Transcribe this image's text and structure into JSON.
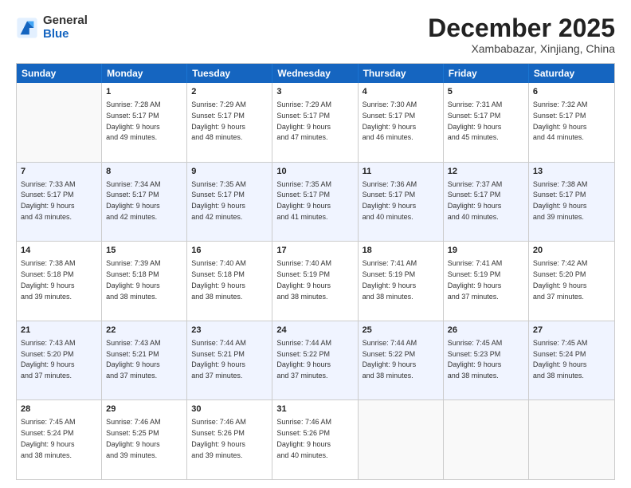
{
  "logo": {
    "general": "General",
    "blue": "Blue"
  },
  "header": {
    "month": "December 2025",
    "location": "Xambabazar, Xinjiang, China"
  },
  "days": [
    "Sunday",
    "Monday",
    "Tuesday",
    "Wednesday",
    "Thursday",
    "Friday",
    "Saturday"
  ],
  "weeks": [
    [
      {
        "empty": true
      },
      {
        "day": "1",
        "sunrise": "7:28 AM",
        "sunset": "5:17 PM",
        "daylight": "9 hours and 49 minutes."
      },
      {
        "day": "2",
        "sunrise": "7:29 AM",
        "sunset": "5:17 PM",
        "daylight": "9 hours and 48 minutes."
      },
      {
        "day": "3",
        "sunrise": "7:29 AM",
        "sunset": "5:17 PM",
        "daylight": "9 hours and 47 minutes."
      },
      {
        "day": "4",
        "sunrise": "7:30 AM",
        "sunset": "5:17 PM",
        "daylight": "9 hours and 46 minutes."
      },
      {
        "day": "5",
        "sunrise": "7:31 AM",
        "sunset": "5:17 PM",
        "daylight": "9 hours and 45 minutes."
      },
      {
        "day": "6",
        "sunrise": "7:32 AM",
        "sunset": "5:17 PM",
        "daylight": "9 hours and 44 minutes."
      }
    ],
    [
      {
        "day": "7",
        "sunrise": "7:33 AM",
        "sunset": "5:17 PM",
        "daylight": "9 hours and 43 minutes."
      },
      {
        "day": "8",
        "sunrise": "7:34 AM",
        "sunset": "5:17 PM",
        "daylight": "9 hours and 42 minutes."
      },
      {
        "day": "9",
        "sunrise": "7:35 AM",
        "sunset": "5:17 PM",
        "daylight": "9 hours and 42 minutes."
      },
      {
        "day": "10",
        "sunrise": "7:35 AM",
        "sunset": "5:17 PM",
        "daylight": "9 hours and 41 minutes."
      },
      {
        "day": "11",
        "sunrise": "7:36 AM",
        "sunset": "5:17 PM",
        "daylight": "9 hours and 40 minutes."
      },
      {
        "day": "12",
        "sunrise": "7:37 AM",
        "sunset": "5:17 PM",
        "daylight": "9 hours and 40 minutes."
      },
      {
        "day": "13",
        "sunrise": "7:38 AM",
        "sunset": "5:17 PM",
        "daylight": "9 hours and 39 minutes."
      }
    ],
    [
      {
        "day": "14",
        "sunrise": "7:38 AM",
        "sunset": "5:18 PM",
        "daylight": "9 hours and 39 minutes."
      },
      {
        "day": "15",
        "sunrise": "7:39 AM",
        "sunset": "5:18 PM",
        "daylight": "9 hours and 38 minutes."
      },
      {
        "day": "16",
        "sunrise": "7:40 AM",
        "sunset": "5:18 PM",
        "daylight": "9 hours and 38 minutes."
      },
      {
        "day": "17",
        "sunrise": "7:40 AM",
        "sunset": "5:19 PM",
        "daylight": "9 hours and 38 minutes."
      },
      {
        "day": "18",
        "sunrise": "7:41 AM",
        "sunset": "5:19 PM",
        "daylight": "9 hours and 38 minutes."
      },
      {
        "day": "19",
        "sunrise": "7:41 AM",
        "sunset": "5:19 PM",
        "daylight": "9 hours and 37 minutes."
      },
      {
        "day": "20",
        "sunrise": "7:42 AM",
        "sunset": "5:20 PM",
        "daylight": "9 hours and 37 minutes."
      }
    ],
    [
      {
        "day": "21",
        "sunrise": "7:43 AM",
        "sunset": "5:20 PM",
        "daylight": "9 hours and 37 minutes."
      },
      {
        "day": "22",
        "sunrise": "7:43 AM",
        "sunset": "5:21 PM",
        "daylight": "9 hours and 37 minutes."
      },
      {
        "day": "23",
        "sunrise": "7:44 AM",
        "sunset": "5:21 PM",
        "daylight": "9 hours and 37 minutes."
      },
      {
        "day": "24",
        "sunrise": "7:44 AM",
        "sunset": "5:22 PM",
        "daylight": "9 hours and 37 minutes."
      },
      {
        "day": "25",
        "sunrise": "7:44 AM",
        "sunset": "5:22 PM",
        "daylight": "9 hours and 38 minutes."
      },
      {
        "day": "26",
        "sunrise": "7:45 AM",
        "sunset": "5:23 PM",
        "daylight": "9 hours and 38 minutes."
      },
      {
        "day": "27",
        "sunrise": "7:45 AM",
        "sunset": "5:24 PM",
        "daylight": "9 hours and 38 minutes."
      }
    ],
    [
      {
        "day": "28",
        "sunrise": "7:45 AM",
        "sunset": "5:24 PM",
        "daylight": "9 hours and 38 minutes."
      },
      {
        "day": "29",
        "sunrise": "7:46 AM",
        "sunset": "5:25 PM",
        "daylight": "9 hours and 39 minutes."
      },
      {
        "day": "30",
        "sunrise": "7:46 AM",
        "sunset": "5:26 PM",
        "daylight": "9 hours and 39 minutes."
      },
      {
        "day": "31",
        "sunrise": "7:46 AM",
        "sunset": "5:26 PM",
        "daylight": "9 hours and 40 minutes."
      },
      {
        "empty": true
      },
      {
        "empty": true
      },
      {
        "empty": true
      }
    ]
  ],
  "labels": {
    "sunrise": "Sunrise:",
    "sunset": "Sunset:",
    "daylight": "Daylight:"
  }
}
